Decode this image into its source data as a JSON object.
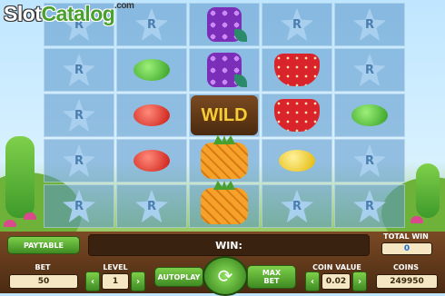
{
  "watermark": {
    "part1": "Slot",
    "part2": "Catalog",
    "suffix": ".com"
  },
  "reels": [
    [
      "R",
      "R",
      "R",
      "R",
      "R"
    ],
    [
      "R",
      "green",
      "red",
      "red",
      "R"
    ],
    [
      "grape",
      "grape",
      "WILD",
      "pineapple",
      "pineapple"
    ],
    [
      "R",
      "strawberry",
      "strawberry",
      "yellow",
      "R"
    ],
    [
      "R",
      "R",
      "green",
      "R",
      "R"
    ]
  ],
  "wild_label": "WILD",
  "star_letter": "R",
  "controls": {
    "paytable": "PAYTABLE",
    "win_label": "WIN:",
    "total_win_label": "TOTAL WIN",
    "total_win_value": "0",
    "bet_label": "BET",
    "bet_value": "50",
    "level_label": "LEVEL",
    "level_value": "1",
    "autoplay": "AUTOPLAY",
    "max_bet_line1": "MAX",
    "max_bet_line2": "BET",
    "coin_value_label": "COIN VALUE",
    "coin_value": "0.02",
    "coins_label": "COINS",
    "coins_value": "249950",
    "arrow_left": "‹",
    "arrow_right": "›",
    "spin_glyph": "⟳"
  },
  "colors": {
    "accent_green": "#4aa02c",
    "panel_brown": "#5a3418",
    "wild_gold": "#f6cc3a"
  }
}
